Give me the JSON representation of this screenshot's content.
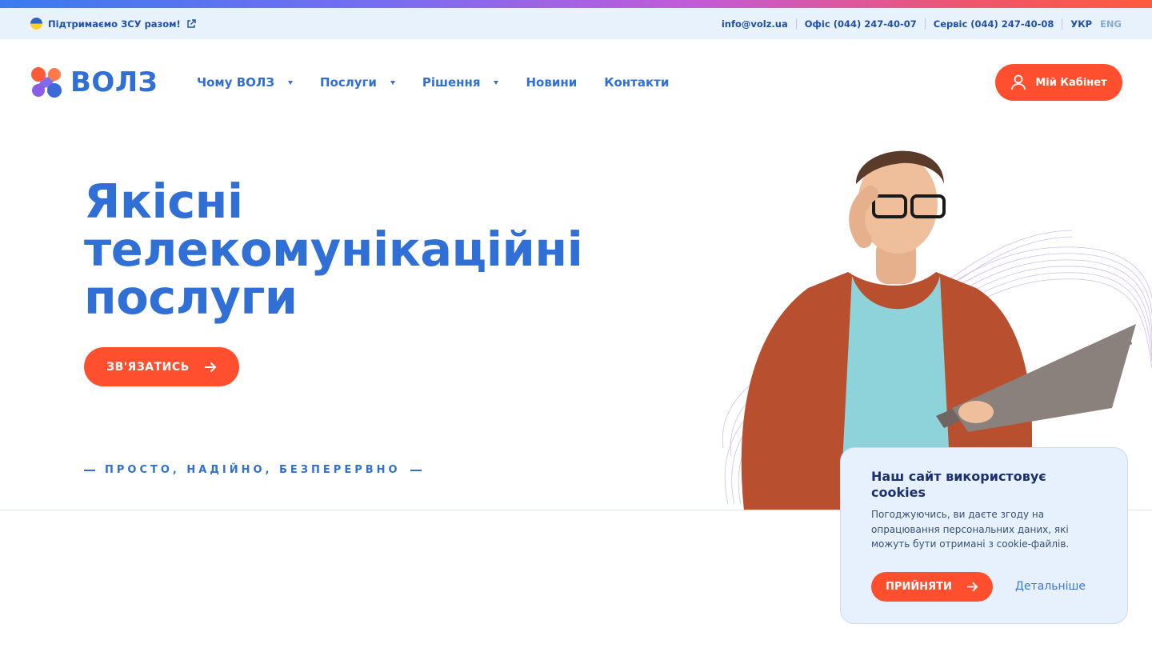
{
  "topbar": {
    "support_text": "Підтримаємо ЗСУ разом!",
    "email": "info@volz.ua",
    "office_phone": "Офіс (044) 247-40-07",
    "service_phone": "Сервіс (044) 247-40-08",
    "lang_active": "УКР",
    "lang_inactive": "ENG"
  },
  "header": {
    "logo_text": "ВОЛЗ",
    "nav": [
      {
        "label": "Чому ВОЛЗ"
      },
      {
        "label": "Послуги"
      },
      {
        "label": "Рішення"
      },
      {
        "label": "Новини"
      },
      {
        "label": "Контакти"
      }
    ],
    "cabinet_label": "Мій Кабінет"
  },
  "hero": {
    "title_line1": "Якісні",
    "title_line2": "телекомунікаційні",
    "title_line3": "послуги",
    "cta_label": "ЗВ'ЯЗАТИСЬ",
    "slogan": "ПРОСТО, НАДІЙНО, БЕЗПЕРЕРВНО"
  },
  "cookie": {
    "title": "Наш сайт використовує cookies",
    "text": "Погоджуючись, ви даєте згоду на опрацювання персональних даних, які можуть бути отримані з cookie-файлів.",
    "accept_label": "ПРИЙНЯТИ",
    "details_label": "Детальніше"
  },
  "colors": {
    "brand_blue": "#2f6fd6",
    "accent_orange": "#ff4f2e",
    "topbar_bg": "#e8f2fd",
    "cookie_bg": "#e6f1fd"
  },
  "icons": [
    "ukraine-flag-icon",
    "external-link-icon",
    "chevron-down-icon",
    "user-icon",
    "arrow-right-icon"
  ]
}
